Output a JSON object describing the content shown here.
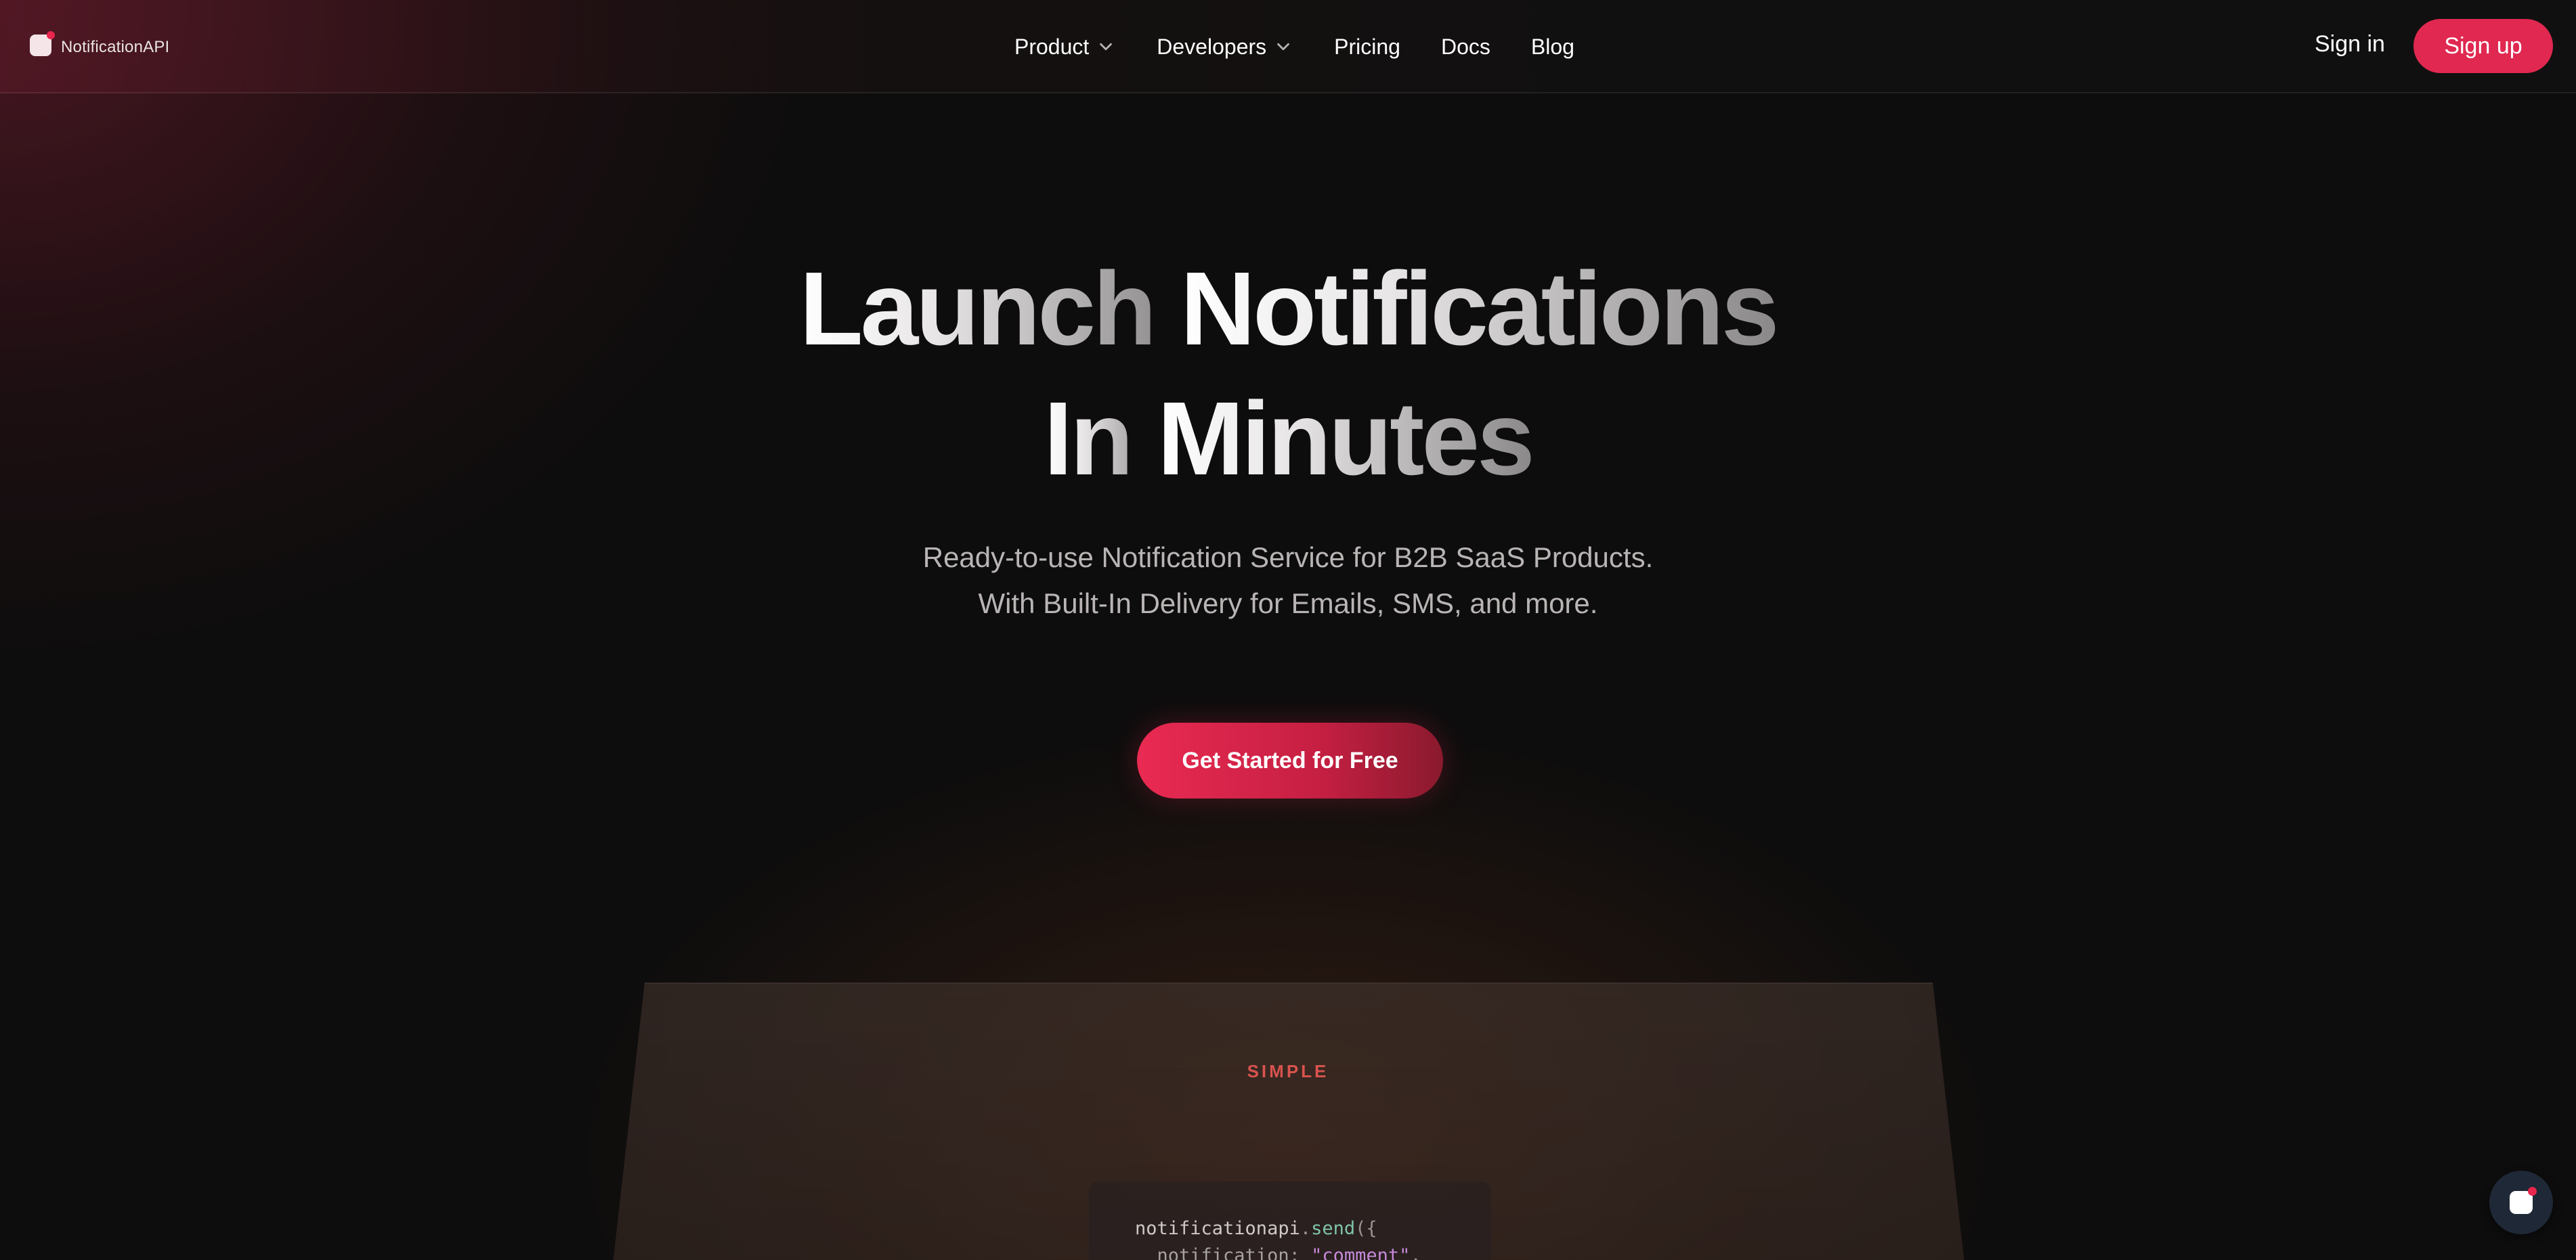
{
  "brand": {
    "name": "NotificationAPI",
    "logo_icon": "notification-app-icon",
    "accent_color": "#e8264e"
  },
  "nav": {
    "items": [
      {
        "label": "Product",
        "has_dropdown": true
      },
      {
        "label": "Developers",
        "has_dropdown": true
      },
      {
        "label": "Pricing",
        "has_dropdown": false
      },
      {
        "label": "Docs",
        "has_dropdown": false
      },
      {
        "label": "Blog",
        "has_dropdown": false
      }
    ],
    "sign_in": "Sign in",
    "sign_up": "Sign up"
  },
  "hero": {
    "title_line1_a": "Launch ",
    "title_line1_b": "Notifications",
    "title_line2_a": "In ",
    "title_line2_b": "Minutes",
    "subtitle_line1": "Ready-to-use Notification Service for B2B SaaS Products.",
    "subtitle_line2": "With Built-In Delivery for Emails, SMS, and more.",
    "cta": "Get Started for Free"
  },
  "feature": {
    "label": "SIMPLE",
    "code": {
      "line1_obj": "notificationapi",
      "line1_dot": ".",
      "line1_fn": "send",
      "line1_open": "({",
      "line2_key": "notification",
      "line2_colon": ": ",
      "line2_str": "\"comment\"",
      "line2_comma": ","
    }
  },
  "chat_widget": {
    "icon": "chat-widget-icon",
    "bg_color": "#1f2836"
  }
}
